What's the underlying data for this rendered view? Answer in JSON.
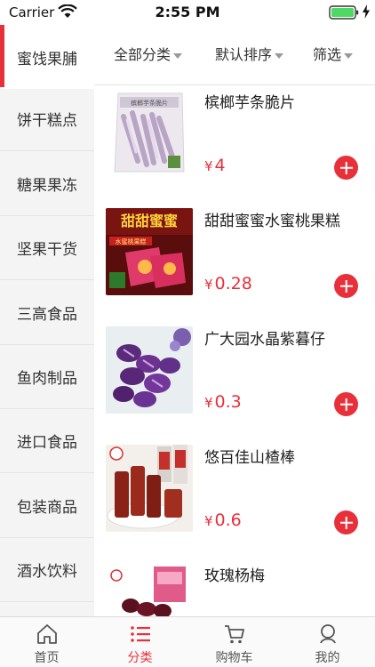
{
  "status_bar": {
    "carrier": "Carrier",
    "time": "2:55 PM",
    "battery_color": "#4cd964"
  },
  "sidebar": {
    "active_color": "#e8303a",
    "items": [
      {
        "label": "蜜饯果脯",
        "active": true
      },
      {
        "label": "饼干糕点",
        "active": false
      },
      {
        "label": "糖果果冻",
        "active": false
      },
      {
        "label": "坚果干货",
        "active": false
      },
      {
        "label": "三高食品",
        "active": false
      },
      {
        "label": "鱼肉制品",
        "active": false
      },
      {
        "label": "进口食品",
        "active": false
      },
      {
        "label": "包装商品",
        "active": false
      },
      {
        "label": "酒水饮料",
        "active": false
      }
    ]
  },
  "filters": {
    "category": "全部分类",
    "sort": "默认排序",
    "filter": "筛选"
  },
  "products": [
    {
      "name": "槟榔芋条脆片",
      "currency": "¥",
      "price": "4",
      "image": "taro-chips-bag"
    },
    {
      "name": "甜甜蜜蜜水蜜桃果糕",
      "currency": "¥",
      "price": "0.28",
      "image": "peach-cake-box"
    },
    {
      "name": "广大园水晶紫暮仔",
      "currency": "¥",
      "price": "0.3",
      "image": "purple-candies"
    },
    {
      "name": "悠百佳山楂棒",
      "currency": "¥",
      "price": "0.6",
      "image": "hawthorn-sticks"
    },
    {
      "name": "玫瑰杨梅",
      "currency": "¥",
      "price": "",
      "image": "rose-bayberry-pack"
    }
  ],
  "tabbar": {
    "active_color": "#e8303a",
    "tabs": [
      {
        "label": "首页",
        "icon": "home-icon",
        "active": false
      },
      {
        "label": "分类",
        "icon": "list-icon",
        "active": true
      },
      {
        "label": "购物车",
        "icon": "cart-icon",
        "active": false
      },
      {
        "label": "我的",
        "icon": "profile-icon",
        "active": false
      }
    ]
  }
}
